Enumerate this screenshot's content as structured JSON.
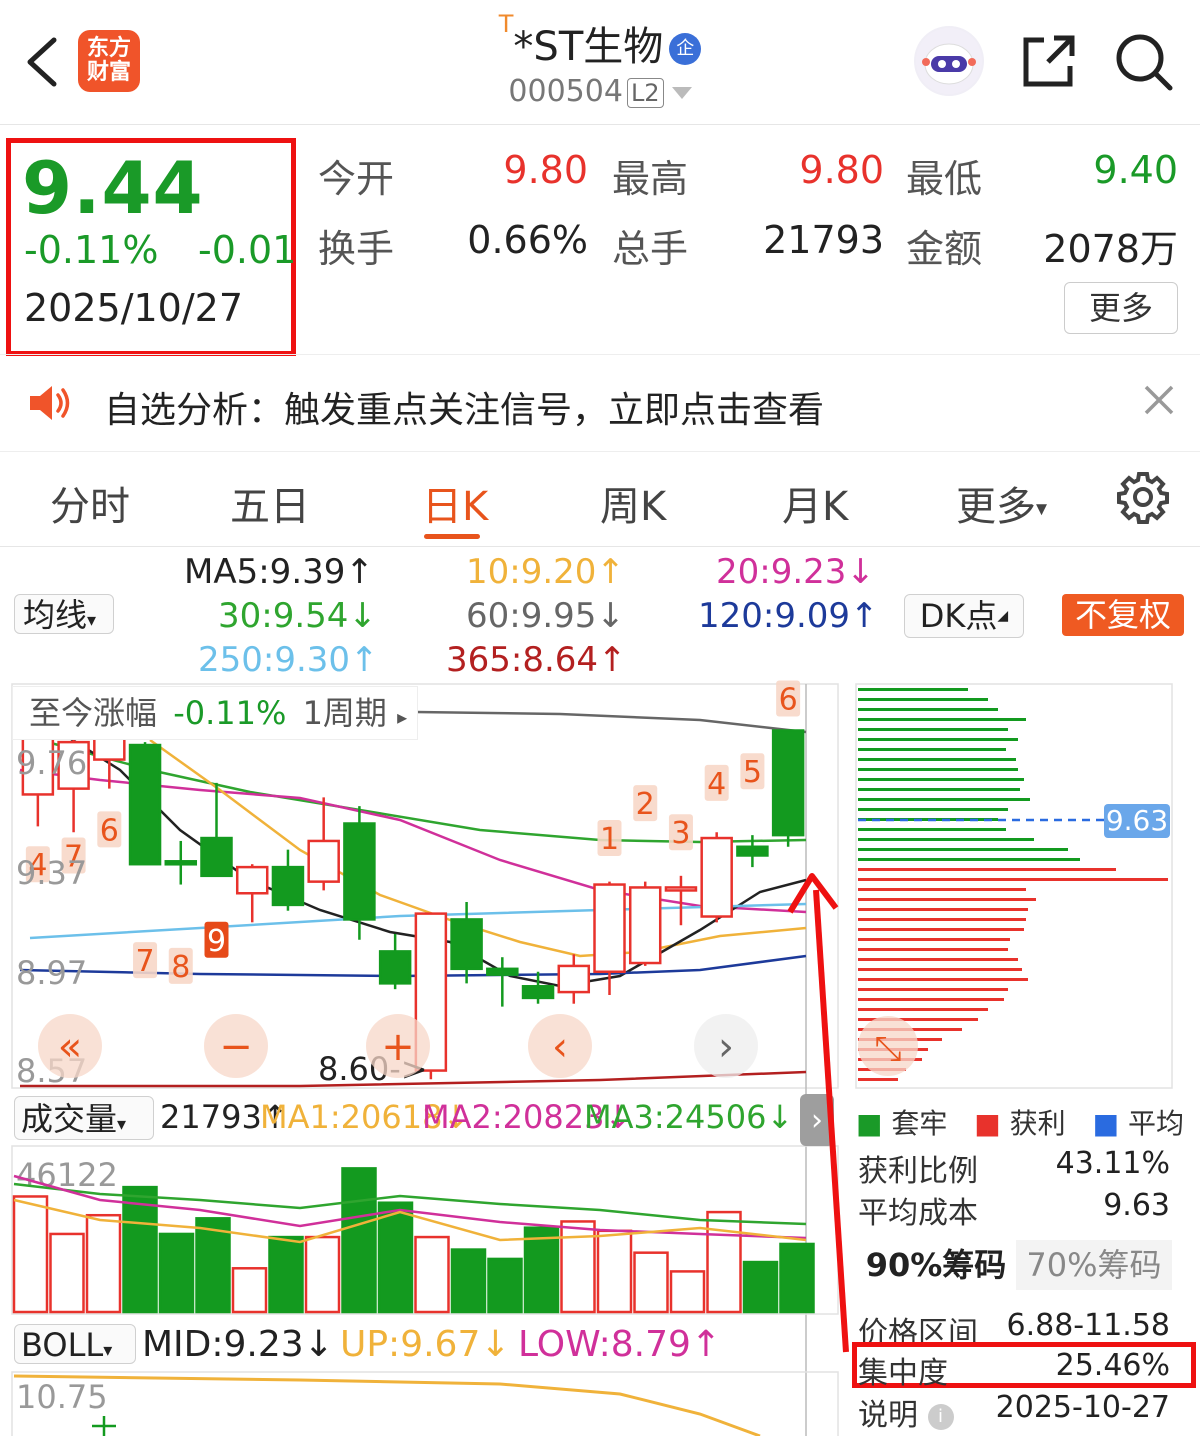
{
  "header": {
    "title_mark": "T",
    "title": "*ST生物",
    "qi_badge": "企",
    "code": "000504",
    "l2": "L2",
    "logo_line1": "东方",
    "logo_line2": "财富"
  },
  "quote": {
    "price": "9.44",
    "change_pct": "-0.11%",
    "change": "-0.01",
    "date": "2025/10/27",
    "stats": [
      {
        "label": "今开",
        "value": "9.80"
      },
      {
        "label": "最高",
        "value": "9.80"
      },
      {
        "label": "最低",
        "value": "9.40"
      },
      {
        "label": "换手",
        "value": "0.66%"
      },
      {
        "label": "总手",
        "value": "21793"
      },
      {
        "label": "金额",
        "value": "2078万"
      }
    ],
    "more_label": "更多"
  },
  "notice": {
    "text": "自选分析：触发重点关注信号，立即点击查看"
  },
  "tabs": [
    "分时",
    "五日",
    "日K",
    "周K",
    "月K",
    "更多"
  ],
  "active_tab": "日K",
  "ma": {
    "selector": "均线",
    "ma5": "MA5:9.39↑",
    "ma10": "10:9.20↑",
    "ma20": "20:9.23↓",
    "ma30": "30:9.54↓",
    "ma60": "60:9.95↓",
    "ma120": "120:9.09↑",
    "ma250": "250:9.30↑",
    "ma365": "365:8.64↑",
    "dk": "DK点",
    "fuquan": "不复权"
  },
  "colors": {
    "up": "#e8322c",
    "down": "#139a1f",
    "accent": "#ef5a22",
    "ma5": "#222222",
    "ma10": "#f0b23a",
    "ma20": "#d0309a",
    "ma30": "#2fa52f",
    "ma60": "#666666",
    "ma120": "#1d3a9a",
    "ma250": "#6cc0ea",
    "ma365": "#b32020"
  },
  "chart_chip": {
    "label": "至今涨幅",
    "value": "-0.11%",
    "period": "1周期"
  },
  "chart_data": [
    {
      "type": "candlestick",
      "yticks": [
        "9.76",
        "9.37",
        "8.97",
        "8.57"
      ],
      "ylim": [
        8.57,
        9.96
      ],
      "low_annotation": "8.60->",
      "candles": [
        {
          "o": 9.58,
          "h": 9.85,
          "l": 9.47,
          "c": 9.82
        },
        {
          "o": 9.6,
          "h": 9.82,
          "l": 9.45,
          "c": 9.76
        },
        {
          "o": 9.7,
          "h": 9.88,
          "l": 9.6,
          "c": 9.78
        },
        {
          "o": 9.75,
          "h": 9.76,
          "l": 9.34,
          "c": 9.34
        },
        {
          "o": 9.35,
          "h": 9.42,
          "l": 9.27,
          "c": 9.34
        },
        {
          "o": 9.43,
          "h": 9.62,
          "l": 9.36,
          "c": 9.3
        },
        {
          "o": 9.24,
          "h": 9.34,
          "l": 9.14,
          "c": 9.33
        },
        {
          "o": 9.33,
          "h": 9.39,
          "l": 9.18,
          "c": 9.2
        },
        {
          "o": 9.28,
          "h": 9.57,
          "l": 9.25,
          "c": 9.42
        },
        {
          "o": 9.48,
          "h": 9.54,
          "l": 9.08,
          "c": 9.15
        },
        {
          "o": 9.04,
          "h": 9.1,
          "l": 8.91,
          "c": 8.93
        },
        {
          "o": 8.63,
          "h": 9.17,
          "l": 8.6,
          "c": 9.17
        },
        {
          "o": 9.15,
          "h": 9.21,
          "l": 8.93,
          "c": 8.98
        },
        {
          "o": 8.98,
          "h": 9.02,
          "l": 8.85,
          "c": 8.96
        },
        {
          "o": 8.92,
          "h": 8.97,
          "l": 8.86,
          "c": 8.88
        },
        {
          "o": 8.9,
          "h": 9.03,
          "l": 8.86,
          "c": 8.99
        },
        {
          "o": 8.97,
          "h": 9.28,
          "l": 8.89,
          "c": 9.27
        },
        {
          "o": 9.0,
          "h": 9.28,
          "l": 8.99,
          "c": 9.26
        },
        {
          "o": 9.26,
          "h": 9.3,
          "l": 9.13,
          "c": 9.26
        },
        {
          "o": 9.16,
          "h": 9.45,
          "l": 9.14,
          "c": 9.43
        },
        {
          "o": 9.4,
          "h": 9.44,
          "l": 9.33,
          "c": 9.37
        },
        {
          "o": 9.8,
          "h": 9.8,
          "l": 9.4,
          "c": 9.44
        }
      ],
      "markers": [
        {
          "label": "4",
          "i": 0,
          "y": 9.34
        },
        {
          "label": "7",
          "i": 1,
          "y": 9.37
        },
        {
          "label": "6",
          "i": 2,
          "y": 9.46
        },
        {
          "label": "7",
          "i": 3,
          "y": 9.01
        },
        {
          "label": "8",
          "i": 4,
          "y": 8.99
        },
        {
          "label": "9",
          "i": 5,
          "y": 9.08
        },
        {
          "label": "1",
          "i": 16,
          "y": 9.43
        },
        {
          "label": "2",
          "i": 17,
          "y": 9.55
        },
        {
          "label": "3",
          "i": 18,
          "y": 9.45
        },
        {
          "label": "4",
          "i": 19,
          "y": 9.62
        },
        {
          "label": "5",
          "i": 20,
          "y": 9.66
        },
        {
          "label": "6",
          "i": 21,
          "y": 9.91
        }
      ]
    },
    {
      "type": "bar",
      "name": "成交量",
      "label": "成交量",
      "vol": "21793↑",
      "ma1": "MA1:20618↓",
      "ma2": "MA2:20823↓",
      "ma3": "MA3:24506↓",
      "ytick": "46122",
      "ylim": [
        0,
        46122
      ],
      "values": [
        37000,
        25000,
        31000,
        40000,
        25000,
        30000,
        14000,
        24000,
        24000,
        46000,
        35000,
        24000,
        20000,
        17000,
        27000,
        29000,
        26000,
        19000,
        13000,
        32000,
        16000,
        21793
      ]
    },
    {
      "type": "line",
      "name": "BOLL",
      "label": "BOLL",
      "mid": "MID:9.23↓",
      "up": "UP:9.67↓",
      "low": "LOW:8.79↑",
      "ytick": "10.75"
    }
  ],
  "chips": {
    "current_label": "9.63",
    "legend": [
      "套牢",
      "获利",
      "平均"
    ],
    "profit_ratio_label": "获利比例",
    "profit_ratio": "43.11%",
    "avg_cost_label": "平均成本",
    "avg_cost": "9.63",
    "tab90": "90%筹码",
    "tab70": "70%筹码",
    "price_range_label": "价格区间",
    "price_range": "6.88-11.58",
    "concentration_label": "集中度",
    "concentration": "25.46%",
    "desc_label": "说明",
    "desc_date": "2025-10-27"
  }
}
